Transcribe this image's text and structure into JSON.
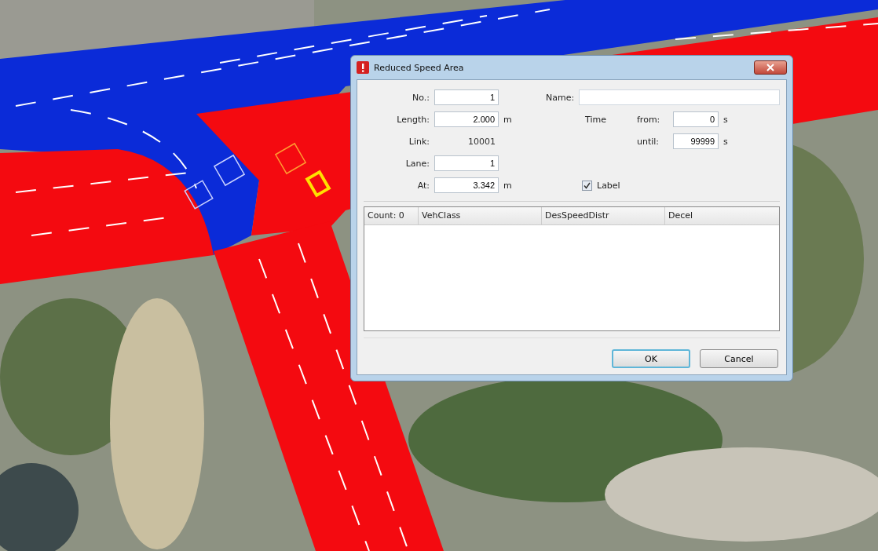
{
  "dialog": {
    "title": "Reduced Speed Area",
    "fields_left": [
      {
        "kind": "input",
        "label": "No.:",
        "value": "1"
      },
      {
        "kind": "input",
        "label": "Length:",
        "value": "2.000",
        "unit": "m"
      },
      {
        "kind": "text",
        "label": "Link:",
        "value": "10001"
      },
      {
        "kind": "input",
        "label": "Lane:",
        "value": "1"
      },
      {
        "kind": "input",
        "label": "At:",
        "value": "3.342",
        "unit": "m"
      }
    ],
    "name_field": {
      "label": "Name:"
    },
    "time": {
      "label": "Time",
      "from_label": "from:",
      "from_value": "0",
      "from_unit": "s",
      "until_label": "until:",
      "until_value": "99999",
      "until_unit": "s"
    },
    "label_checkbox": {
      "label": "Label",
      "checked": true
    },
    "table": {
      "count": "Count: 0",
      "columns": [
        "VehClass",
        "DesSpeedDistr",
        "Decel"
      ]
    },
    "buttons": [
      {
        "label": "OK",
        "default": true
      },
      {
        "label": "Cancel",
        "default": false
      }
    ]
  }
}
